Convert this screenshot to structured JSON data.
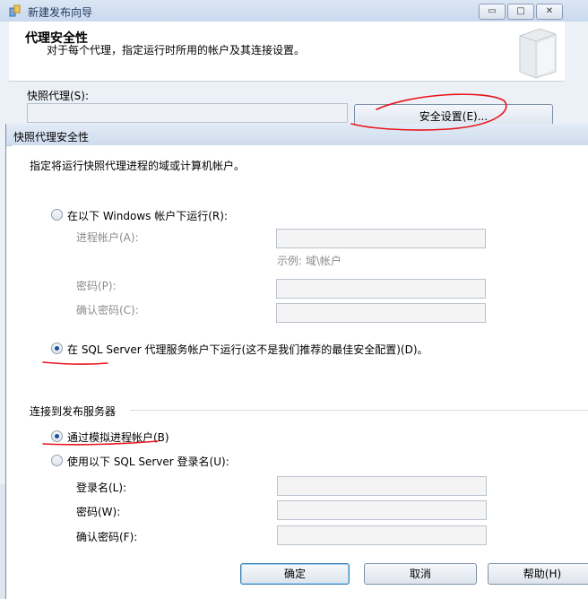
{
  "wizard": {
    "title": "新建发布向导",
    "header_title": "代理安全性",
    "header_subtitle": "对于每个代理，指定运行时所用的帐户及其连接设置。",
    "snapshot_agent_label": "快照代理(S):",
    "security_settings_button": "安全设置(E)...",
    "window_controls": {
      "minimize": "▭",
      "maximize": "□",
      "close": "✕"
    }
  },
  "dialog": {
    "title": "快照代理安全性",
    "instruction": "指定将运行快照代理进程的域或计算机帐户。",
    "run_under_windows_account": {
      "label": "在以下 Windows 帐户下运行(R):",
      "checked": false,
      "process_account_label": "进程帐户(A):",
      "process_account_value": "",
      "example_text": "示例: 域\\帐户",
      "password_label": "密码(P):",
      "password_value": "",
      "confirm_password_label": "确认密码(C):",
      "confirm_password_value": ""
    },
    "run_under_sql_agent": {
      "label": "在 SQL Server 代理服务帐户下运行(这不是我们推荐的最佳安全配置)(D)。",
      "checked": true
    },
    "connect_publisher": {
      "group_label": "连接到发布服务器",
      "impersonate_label": "通过模拟进程帐户(B)",
      "impersonate_checked": true,
      "sql_login_label": "使用以下 SQL Server 登录名(U):",
      "sql_login_checked": false,
      "login_name_label": "登录名(L):",
      "login_name_value": "",
      "password_label": "密码(W):",
      "password_value": "",
      "confirm_password_label": "确认密码(F):",
      "confirm_password_value": ""
    },
    "buttons": {
      "ok": "确定",
      "cancel": "取消",
      "help": "帮助(H)"
    }
  },
  "colors": {
    "annotation": "#e8141a",
    "accent": "#1c4f9c"
  }
}
